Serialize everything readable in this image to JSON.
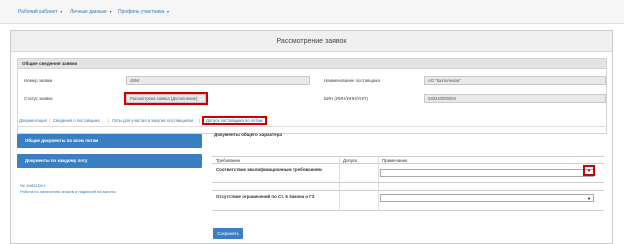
{
  "topnav": {
    "items": [
      {
        "label": "Рабочий кабинет"
      },
      {
        "label": "Личные данные"
      },
      {
        "label": "Профиль участника"
      }
    ]
  },
  "page": {
    "title": "Рассмотрение заявок"
  },
  "general": {
    "title": "Общие сведения заявки",
    "app_number_label": "Номер заявки",
    "app_number_value": "4894",
    "status_label": "Статус заявки",
    "status_value": "Рассмотрена заявка (Дополнение)",
    "supplier_name_label": "Наименование поставщика",
    "supplier_name_value": "АО \"Казтелеком\"",
    "bin_label": "БИН (ИИН/ИНН/УНП)",
    "bin_value": "020240000004"
  },
  "tabs": [
    {
      "label": "Документация"
    },
    {
      "label": "Сведения о поставщике"
    },
    {
      "label": "Лоты для участия в закупке поставщиком"
    },
    {
      "label": "Допуск поставщика по лотам"
    }
  ],
  "left": {
    "btn_common": "Общие документы по всем лотам",
    "btn_by_lot": "Документы по каждому лоту",
    "lot_number": "№: 84851DK1",
    "lot_desc": "Работа по нанесению знаков и надписей на вагоны"
  },
  "right": {
    "section_title": "Документы общего характера",
    "col_requirement": "Требование",
    "col_access": "Допуск",
    "col_note": "Примечание",
    "row1": "Соответствие квалификационным требованиям",
    "row2": "Отсутствие ограничений по Ст. 6 Закона о ГЗ",
    "save_label": "Сохранить"
  }
}
